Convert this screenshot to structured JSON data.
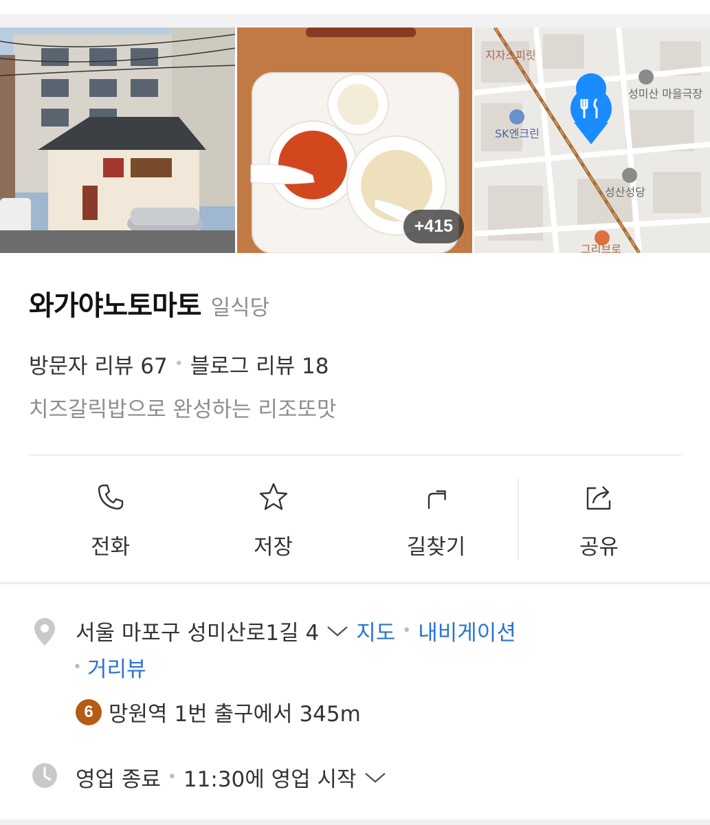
{
  "photos": {
    "more_count": "+415"
  },
  "map": {
    "labels": [
      "지자스피릿",
      "성미산 마을극장",
      "SK엔크린",
      "성산성당",
      "그리브로"
    ]
  },
  "place": {
    "name": "와가야노토마토",
    "category": "일식당",
    "visitor_reviews": "방문자 리뷰 67",
    "blog_reviews": "블로그 리뷰 18",
    "description": "치즈갈릭밥으로 완성하는 리조또맛"
  },
  "actions": [
    {
      "label": "전화",
      "icon": "phone-icon"
    },
    {
      "label": "저장",
      "icon": "star-icon"
    },
    {
      "label": "길찾기",
      "icon": "directions-icon"
    },
    {
      "label": "공유",
      "icon": "share-icon"
    }
  ],
  "address": {
    "text": "서울 마포구 성미산로1길 4",
    "map_link": "지도",
    "navigation_link": "내비게이션",
    "streetview_link": "거리뷰"
  },
  "metro": {
    "line": "6",
    "line_color": "#b45b14",
    "text": "망원역 1번 출구에서 345m"
  },
  "hours": {
    "status": "영업 종료",
    "next": "11:30에 영업 시작"
  },
  "colors": {
    "link": "#2873d6",
    "pin": "#1a8cff"
  }
}
